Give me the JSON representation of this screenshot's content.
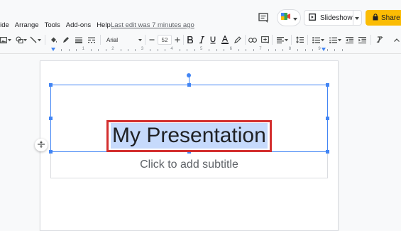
{
  "menu": {
    "items": [
      "lide",
      "Arrange",
      "Tools",
      "Add-ons",
      "Help"
    ],
    "last_edit": "Last edit was 7 minutes ago"
  },
  "header": {
    "slideshow_label": "Slideshow",
    "share_label": "Share"
  },
  "toolbar": {
    "font": "Arial",
    "font_size": "52",
    "icons": [
      "image-icon",
      "shape-icon",
      "line-icon",
      "paint-bucket-icon",
      "pen-icon",
      "border-weight-icon",
      "border-dash-icon",
      "decrease-font-icon",
      "increase-font-icon",
      "bold-icon",
      "italic-icon",
      "underline-icon",
      "text-color-icon",
      "highlight-icon",
      "link-icon",
      "add-comment-icon",
      "align-icon",
      "line-spacing-icon",
      "bulleted-list-icon",
      "numbered-list-icon",
      "decrease-indent-icon",
      "increase-indent-icon"
    ]
  },
  "ruler": {
    "numbers": [
      "1",
      "2",
      "3",
      "4",
      "5",
      "6",
      "7",
      "8",
      "9"
    ]
  },
  "slide": {
    "title": "My Presentation",
    "subtitle_placeholder": "Click to add subtitle"
  },
  "colors": {
    "accent": "#4285f4",
    "share": "#fbbc04",
    "highlight": "#c6dafc",
    "annotation": "#d32f2f"
  }
}
